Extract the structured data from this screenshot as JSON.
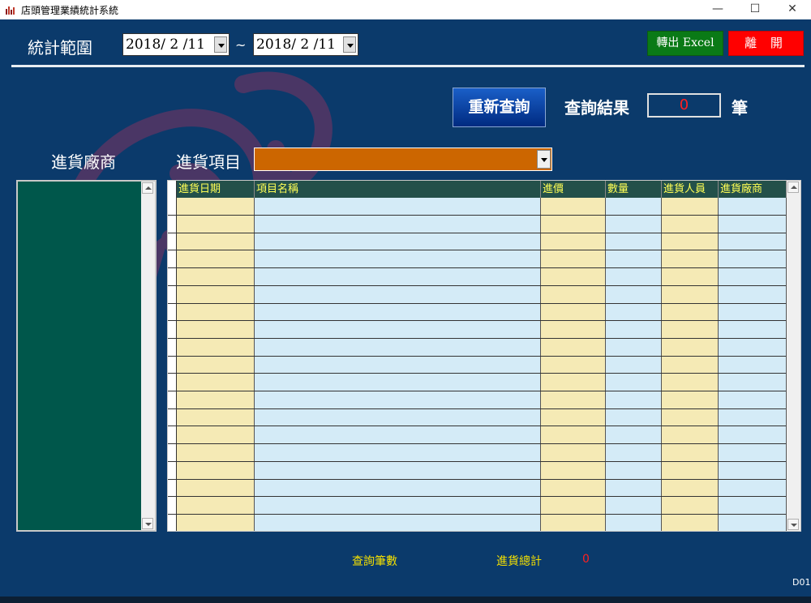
{
  "window": {
    "title": "店頭管理業績統計系統",
    "minimize_glyph": "—",
    "maximize_glyph": "☐",
    "close_glyph": "✕",
    "icon": "bar-chart-icon"
  },
  "filter": {
    "range_label": "統計範圍",
    "date_from": "2018/ 2 /11",
    "separator": "~",
    "date_to": "2018/ 2 /11",
    "vendor_label": "進貨廠商",
    "item_label": "進貨項目",
    "item_value": ""
  },
  "actions": {
    "export_label": "轉出 Excel",
    "exit_label": "離 開",
    "requery_label": "重新查詢"
  },
  "result": {
    "label": "查詢結果",
    "count": "0",
    "unit": "筆"
  },
  "grid": {
    "columns": [
      "進貨日期",
      "項目名稱",
      "進價",
      "數量",
      "進貨人員",
      "進貨廠商"
    ],
    "rows": []
  },
  "footer": {
    "count_label": "查詢筆數",
    "total_label": "進貨總計",
    "total_value": "0",
    "form_code": "D01"
  },
  "colors": {
    "background": "#0b3a6b",
    "export_button": "#0a7a16",
    "exit_button": "#ff0000",
    "item_combo": "#cc6600",
    "vendor_list": "#00574b",
    "grid_header": "#23504a",
    "grid_col_beige": "#f5eab5",
    "grid_col_blue": "#d4ebf7",
    "highlight_text": "#f5e000",
    "value_text": "#ff2020"
  }
}
